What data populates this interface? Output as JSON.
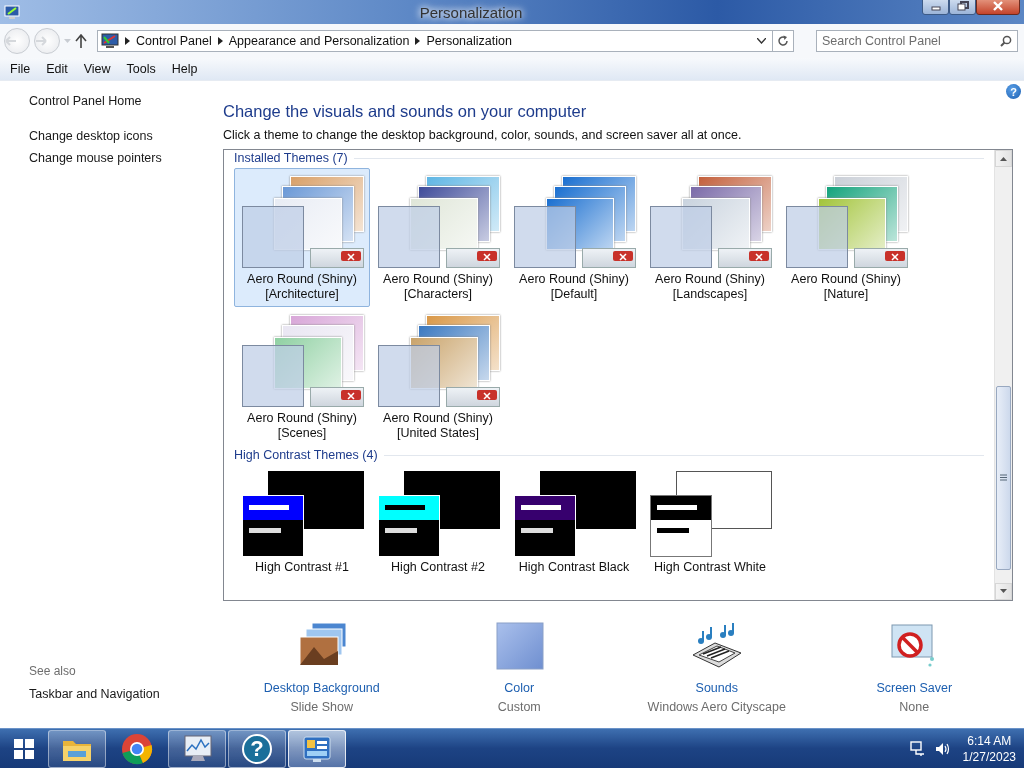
{
  "window": {
    "title": "Personalization"
  },
  "address_bar": {
    "path": [
      "Control Panel",
      "Appearance and Personalization",
      "Personalization"
    ]
  },
  "search": {
    "placeholder": "Search Control Panel"
  },
  "menu": [
    "File",
    "Edit",
    "View",
    "Tools",
    "Help"
  ],
  "sidebar": {
    "links": [
      "Control Panel Home",
      "Change desktop icons",
      "Change mouse pointers"
    ],
    "see_also": {
      "heading": "See also",
      "links": [
        "Taskbar and Navigation"
      ]
    }
  },
  "main": {
    "help": "?",
    "title": "Change the visuals and sounds on your computer",
    "description": "Click a theme to change the desktop background, color, sounds, and screen saver all at once.",
    "groups": [
      {
        "heading": "Installed Themes (7)",
        "themes": [
          {
            "kind": "aero",
            "name": "Aero Round (Shiny)",
            "subtitle": "[Architecture]",
            "selected": true
          },
          {
            "kind": "aero",
            "name": "Aero Round (Shiny)",
            "subtitle": "[Characters]",
            "selected": false
          },
          {
            "kind": "aero",
            "name": "Aero Round (Shiny)",
            "subtitle": "[Default]",
            "selected": false
          },
          {
            "kind": "aero",
            "name": "Aero Round (Shiny)",
            "subtitle": "[Landscapes]",
            "selected": false
          },
          {
            "kind": "aero",
            "name": "Aero Round (Shiny)",
            "subtitle": "[Nature]",
            "selected": false
          },
          {
            "kind": "aero",
            "name": "Aero Round (Shiny)",
            "subtitle": "[Scenes]",
            "selected": false
          },
          {
            "kind": "aero",
            "name": "Aero Round (Shiny)",
            "subtitle": "[United States]",
            "selected": false
          }
        ]
      },
      {
        "heading": "High Contrast Themes (4)",
        "themes": [
          {
            "kind": "high-contrast-dark",
            "name": "High Contrast #1",
            "color": "#0000ff",
            "selected": false
          },
          {
            "kind": "high-contrast-dark",
            "name": "High Contrast #2",
            "color": "#00ffff",
            "selected": false
          },
          {
            "kind": "high-contrast-dark",
            "name": "High Contrast Black",
            "color": "#37006e",
            "selected": false
          },
          {
            "kind": "high-contrast-light",
            "name": "High Contrast White",
            "color": "#000000",
            "selected": false
          }
        ]
      }
    ],
    "settings": [
      {
        "kind": "background",
        "label": "Desktop Background",
        "value": "Slide Show"
      },
      {
        "kind": "color",
        "label": "Color",
        "value": "Custom"
      },
      {
        "kind": "sounds",
        "label": "Sounds",
        "value": "Windows Aero Cityscape"
      },
      {
        "kind": "screensaver",
        "label": "Screen Saver",
        "value": "None"
      }
    ]
  },
  "taskbar": {
    "items": [
      {
        "kind": "explorer",
        "running": true,
        "selected": false
      },
      {
        "kind": "browser",
        "running": false,
        "selected": false
      },
      {
        "kind": "monitor",
        "running": true,
        "selected": false
      },
      {
        "kind": "help",
        "label": "?",
        "running": true,
        "selected": false
      },
      {
        "kind": "control-panel",
        "running": true,
        "selected": true
      }
    ],
    "clock": {
      "time": "6:14 AM",
      "date": "1/27/2023"
    }
  }
}
